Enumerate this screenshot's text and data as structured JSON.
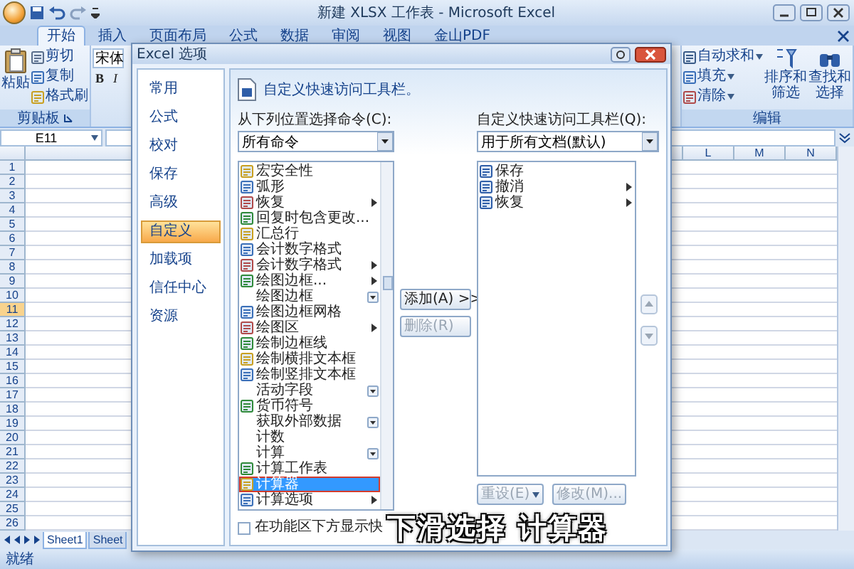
{
  "window": {
    "title": "新建 XLSX 工作表 - Microsoft Excel"
  },
  "ribbon_tabs": [
    {
      "label": "开始",
      "selected": true
    },
    {
      "label": "插入",
      "selected": false
    },
    {
      "label": "页面布局",
      "selected": false
    },
    {
      "label": "公式",
      "selected": false
    },
    {
      "label": "数据",
      "selected": false
    },
    {
      "label": "审阅",
      "selected": false
    },
    {
      "label": "视图",
      "selected": false
    },
    {
      "label": "金山PDF",
      "selected": false
    }
  ],
  "clipboard_group": {
    "paste": "粘贴",
    "commands": [
      "剪切",
      "复制",
      "格式刷"
    ],
    "label": "剪贴板"
  },
  "font_group": {
    "font": "宋体",
    "bold": "B",
    "italic": "I"
  },
  "editing_group": {
    "commands": [
      "自动求和",
      "填充",
      "清除"
    ],
    "sort": "排序和筛选",
    "find": "查找和选择",
    "label": "编辑"
  },
  "name_box": "E11",
  "columns": [
    "L",
    "M",
    "N"
  ],
  "rows": [
    {
      "number": "1",
      "selected": false
    },
    {
      "number": "2",
      "selected": false
    },
    {
      "number": "3",
      "selected": false
    },
    {
      "number": "4",
      "selected": false
    },
    {
      "number": "5",
      "selected": false
    },
    {
      "number": "6",
      "selected": false
    },
    {
      "number": "7",
      "selected": false
    },
    {
      "number": "8",
      "selected": false
    },
    {
      "number": "9",
      "selected": false
    },
    {
      "number": "10",
      "selected": false
    },
    {
      "number": "11",
      "selected": true
    },
    {
      "number": "12",
      "selected": false
    },
    {
      "number": "13",
      "selected": false
    },
    {
      "number": "14",
      "selected": false
    },
    {
      "number": "15",
      "selected": false
    },
    {
      "number": "16",
      "selected": false
    },
    {
      "number": "17",
      "selected": false
    },
    {
      "number": "18",
      "selected": false
    },
    {
      "number": "19",
      "selected": false
    },
    {
      "number": "20",
      "selected": false
    },
    {
      "number": "21",
      "selected": false
    },
    {
      "number": "22",
      "selected": false
    },
    {
      "number": "23",
      "selected": false
    },
    {
      "number": "24",
      "selected": false
    },
    {
      "number": "25",
      "selected": false
    },
    {
      "number": "26",
      "selected": false
    }
  ],
  "sheet_tabs": [
    {
      "label": "Sheet1",
      "selected": true
    },
    {
      "label": "Sheet",
      "selected": false
    }
  ],
  "status_bar": "就绪",
  "dialog": {
    "title": "Excel 选项",
    "nav": [
      {
        "label": "常用",
        "selected": false
      },
      {
        "label": "公式",
        "selected": false
      },
      {
        "label": "校对",
        "selected": false
      },
      {
        "label": "保存",
        "selected": false
      },
      {
        "label": "高级",
        "selected": false
      },
      {
        "label": "自定义",
        "selected": true
      },
      {
        "label": "加载项",
        "selected": false
      },
      {
        "label": "信任中心",
        "selected": false
      },
      {
        "label": "资源",
        "selected": false
      }
    ],
    "heading": "自定义快速访问工具栏。",
    "source_label": "从下列位置选择命令(C):",
    "source_value": "所有命令",
    "commands": [
      {
        "label": "宏安全性",
        "kind": "plain",
        "icon": true,
        "selected": false,
        "highlighted": false
      },
      {
        "label": "弧形",
        "kind": "plain",
        "icon": true,
        "selected": false,
        "highlighted": false
      },
      {
        "label": "恢复",
        "kind": "submenu",
        "icon": true,
        "selected": false,
        "highlighted": false
      },
      {
        "label": "回复时包含更改...",
        "kind": "plain",
        "icon": true,
        "selected": false,
        "highlighted": false
      },
      {
        "label": "汇总行",
        "kind": "plain",
        "icon": true,
        "selected": false,
        "highlighted": false
      },
      {
        "label": "会计数字格式",
        "kind": "plain",
        "icon": true,
        "selected": false,
        "highlighted": false
      },
      {
        "label": "会计数字格式",
        "kind": "submenu",
        "icon": true,
        "selected": false,
        "highlighted": false
      },
      {
        "label": "绘图边框...",
        "kind": "submenu",
        "icon": true,
        "selected": false,
        "highlighted": false
      },
      {
        "label": "绘图边框",
        "kind": "dropdown",
        "icon": false,
        "selected": false,
        "highlighted": false
      },
      {
        "label": "绘图边框网格",
        "kind": "plain",
        "icon": true,
        "selected": false,
        "highlighted": false
      },
      {
        "label": "绘图区",
        "kind": "submenu",
        "icon": true,
        "selected": false,
        "highlighted": false
      },
      {
        "label": "绘制边框线",
        "kind": "plain",
        "icon": true,
        "selected": false,
        "highlighted": false
      },
      {
        "label": "绘制横排文本框",
        "kind": "plain",
        "icon": true,
        "selected": false,
        "highlighted": false
      },
      {
        "label": "绘制竖排文本框",
        "kind": "plain",
        "icon": true,
        "selected": false,
        "highlighted": false
      },
      {
        "label": "活动字段",
        "kind": "dropdown",
        "icon": false,
        "selected": false,
        "highlighted": false
      },
      {
        "label": "货币符号",
        "kind": "plain",
        "icon": true,
        "selected": false,
        "highlighted": false
      },
      {
        "label": "获取外部数据",
        "kind": "dropdown",
        "icon": false,
        "selected": false,
        "highlighted": false
      },
      {
        "label": "计数",
        "kind": "plain",
        "icon": false,
        "selected": false,
        "highlighted": false
      },
      {
        "label": "计算",
        "kind": "dropdown",
        "icon": false,
        "selected": false,
        "highlighted": false
      },
      {
        "label": "计算工作表",
        "kind": "plain",
        "icon": true,
        "selected": false,
        "highlighted": false
      },
      {
        "label": "计算器",
        "kind": "plain",
        "icon": true,
        "selected": true,
        "highlighted": true
      },
      {
        "label": "计算选项",
        "kind": "submenu",
        "icon": true,
        "selected": false,
        "highlighted": false
      }
    ],
    "add_button": "添加(A) >>",
    "remove_button": "删除(R)",
    "target_label": "自定义快速访问工具栏(Q):",
    "target_value": "用于所有文档(默认)",
    "toolbar_items": [
      {
        "label": "保存",
        "kind": "plain"
      },
      {
        "label": "撤消",
        "kind": "submenu"
      },
      {
        "label": "恢复",
        "kind": "submenu"
      }
    ],
    "reset_button": "重设(E)",
    "modify_button": "修改(M)...",
    "below_ribbon": {
      "label": "在功能区下方显示快",
      "checked": false
    }
  },
  "caption": "下滑选择 计算器"
}
